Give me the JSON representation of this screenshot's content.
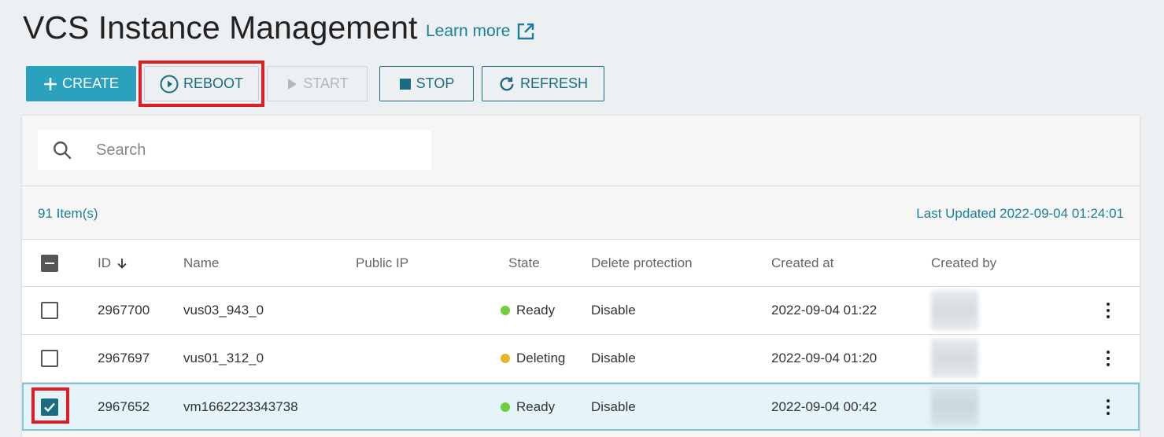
{
  "header": {
    "title": "VCS Instance Management",
    "learn_more": "Learn more"
  },
  "toolbar": {
    "create_label": "CREATE",
    "reboot_label": "REBOOT",
    "start_label": "START",
    "stop_label": "STOP",
    "refresh_label": "REFRESH"
  },
  "search": {
    "placeholder": "Search",
    "value": ""
  },
  "summary": {
    "item_count": "91 Item(s)",
    "last_updated": "Last Updated 2022-09-04 01:24:01"
  },
  "table": {
    "columns": [
      "ID",
      "Name",
      "Public IP",
      "State",
      "Delete protection",
      "Created at",
      "Created by"
    ],
    "rows": [
      {
        "id": "2967700",
        "name": "vus03_943_0",
        "public_ip": "",
        "state": "Ready",
        "state_color": "#6fcf3a",
        "delete_protection": "Disable",
        "created_at": "2022-09-04 01:22",
        "checked": false
      },
      {
        "id": "2967697",
        "name": "vus01_312_0",
        "public_ip": "",
        "state": "Deleting",
        "state_color": "#e8b526",
        "delete_protection": "Disable",
        "created_at": "2022-09-04 01:20",
        "checked": false
      },
      {
        "id": "2967652",
        "name": "vm1662223343738",
        "public_ip": "",
        "state": "Ready",
        "state_color": "#6fcf3a",
        "delete_protection": "Disable",
        "created_at": "2022-09-04 00:42",
        "checked": true
      }
    ]
  },
  "colors": {
    "accent": "#2aa2bd",
    "link": "#1a7f98",
    "highlight": "#e01e25"
  }
}
